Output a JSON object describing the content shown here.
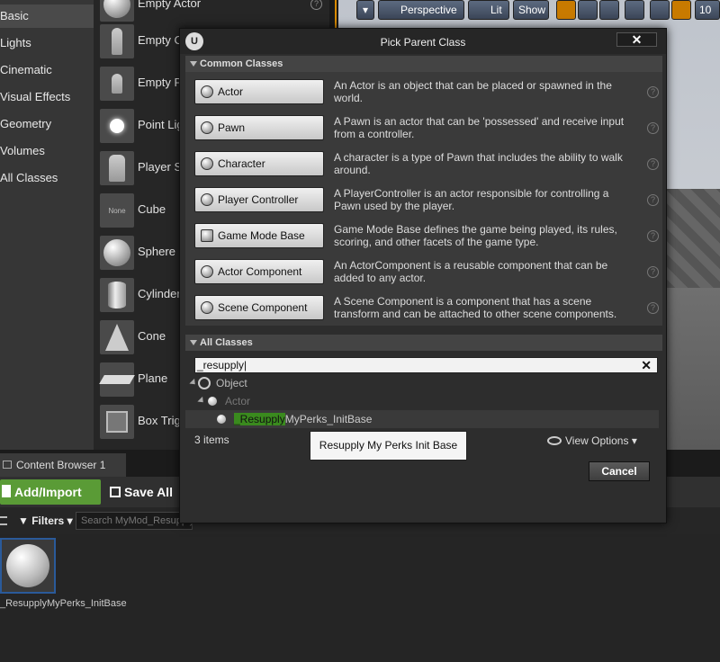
{
  "place_panel": {
    "categories": [
      "Basic",
      "Lights",
      "Cinematic",
      "Visual Effects",
      "Geometry",
      "Volumes",
      "All Classes"
    ],
    "assets": [
      "Empty Actor",
      "Empty C",
      "Empty P",
      "Point Lig",
      "Player S",
      "Cube",
      "Sphere",
      "Cylinder",
      "Cone",
      "Plane",
      "Box Trig"
    ],
    "cube_thumb_text": "None",
    "help_glyph": "?"
  },
  "viewport": {
    "perspective_label": "Perspective",
    "lit_label": "Lit",
    "show_label": "Show",
    "grid_value": "10"
  },
  "content_browser": {
    "tab_label": "Content Browser 1",
    "add_import_label": "Add/Import",
    "save_all_label": "Save All",
    "filters_label": "Filters",
    "search_placeholder": "Search MyMod_Resupply",
    "asset_name": "_ResupplyMyPerks_InitBase"
  },
  "dialog": {
    "title": "Pick Parent Class",
    "close_glyph": "✕",
    "logo_glyph": "U",
    "common_header": "Common Classes",
    "common_classes": [
      {
        "label": "Actor",
        "desc": "An Actor is an object that can be placed or spawned in the world."
      },
      {
        "label": "Pawn",
        "desc": "A Pawn is an actor that can be 'possessed' and receive input from a controller."
      },
      {
        "label": "Character",
        "desc": "A character is a type of Pawn that includes the ability to walk around."
      },
      {
        "label": "Player Controller",
        "desc": "A PlayerController is an actor responsible for controlling a Pawn used by the player."
      },
      {
        "label": "Game Mode Base",
        "desc": "Game Mode Base defines the game being played, its rules, scoring, and other facets of the game type."
      },
      {
        "label": "Actor Component",
        "desc": "An ActorComponent is a reusable component that can be added to any actor."
      },
      {
        "label": "Scene Component",
        "desc": "A Scene Component is a component that has a scene transform and can be attached to other scene components."
      }
    ],
    "all_header": "All Classes",
    "search_value": "_resupply",
    "tree": {
      "object": "Object",
      "actor": "Actor",
      "match_prefix": "_Resupply",
      "match_suffix": "MyPerks_InitBase"
    },
    "item_count": "3 items",
    "view_options": "View Options",
    "tooltip": "Resupply My Perks Init Base",
    "cancel_label": "Cancel"
  }
}
